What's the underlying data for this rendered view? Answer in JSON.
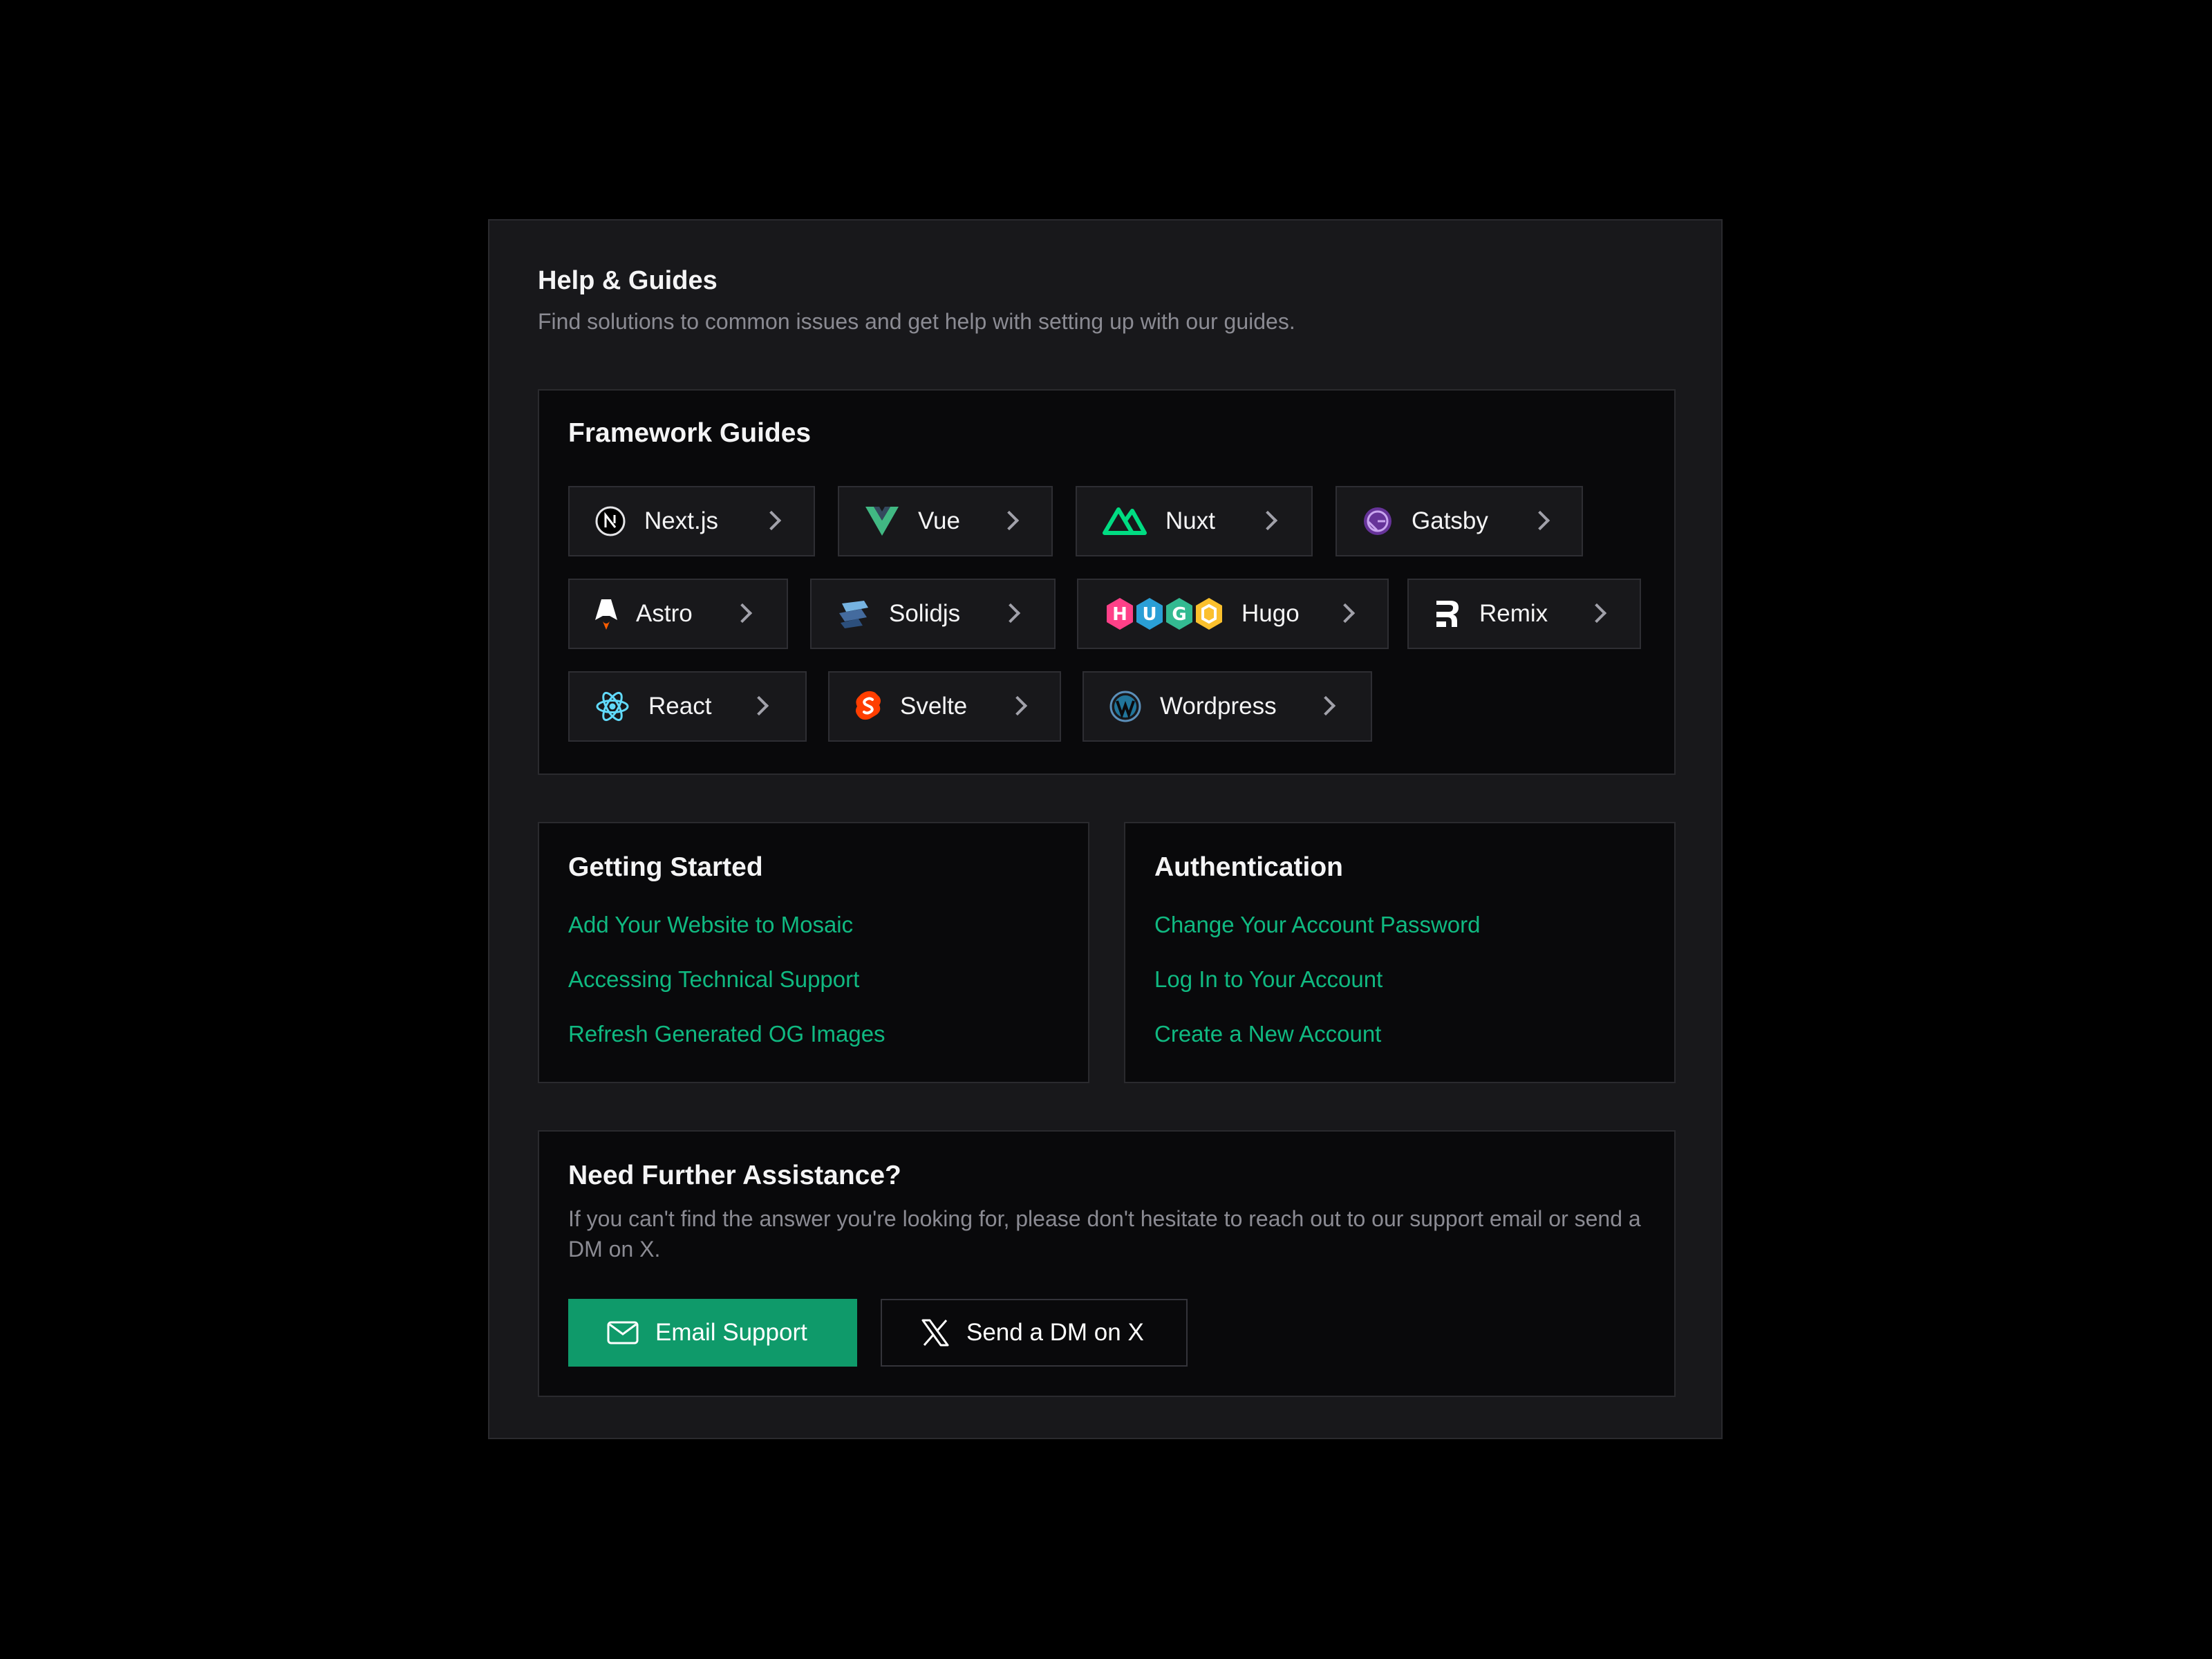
{
  "header": {
    "title": "Help & Guides",
    "subtitle": "Find solutions to common issues and get help with setting up with our guides."
  },
  "framework_guides": {
    "title": "Framework Guides",
    "items": [
      {
        "label": "Next.js",
        "icon": "nextjs-icon"
      },
      {
        "label": "Vue",
        "icon": "vue-icon"
      },
      {
        "label": "Nuxt",
        "icon": "nuxt-icon"
      },
      {
        "label": "Gatsby",
        "icon": "gatsby-icon"
      },
      {
        "label": "Astro",
        "icon": "astro-icon"
      },
      {
        "label": "Solidjs",
        "icon": "solidjs-icon"
      },
      {
        "label": "Hugo",
        "icon": "hugo-icon",
        "icon_letters": [
          "H",
          "U",
          "G",
          "O"
        ]
      },
      {
        "label": "Remix",
        "icon": "remix-icon"
      },
      {
        "label": "React",
        "icon": "react-icon"
      },
      {
        "label": "Svelte",
        "icon": "svelte-icon"
      },
      {
        "label": "Wordpress",
        "icon": "wordpress-icon"
      }
    ]
  },
  "getting_started": {
    "title": "Getting Started",
    "links": [
      "Add Your Website to Mosaic",
      "Accessing Technical Support",
      "Refresh Generated OG Images"
    ]
  },
  "authentication": {
    "title": "Authentication",
    "links": [
      "Change Your Account Password",
      "Log In to Your Account",
      "Create a New Account"
    ]
  },
  "assistance": {
    "title": "Need Further Assistance?",
    "text": "If you can't find the answer you're looking for, please don't hesitate to reach out to our support email or send a DM on X.",
    "email_button": {
      "label": "Email Support",
      "icon": "mail-icon"
    },
    "dm_button": {
      "label": "Send a DM on X",
      "icon": "x-icon"
    }
  },
  "colors": {
    "background": "#000000",
    "card": "#18181b",
    "panel": "#09090b",
    "accent": "#10b981",
    "primary_button": "#0f9a6a"
  }
}
